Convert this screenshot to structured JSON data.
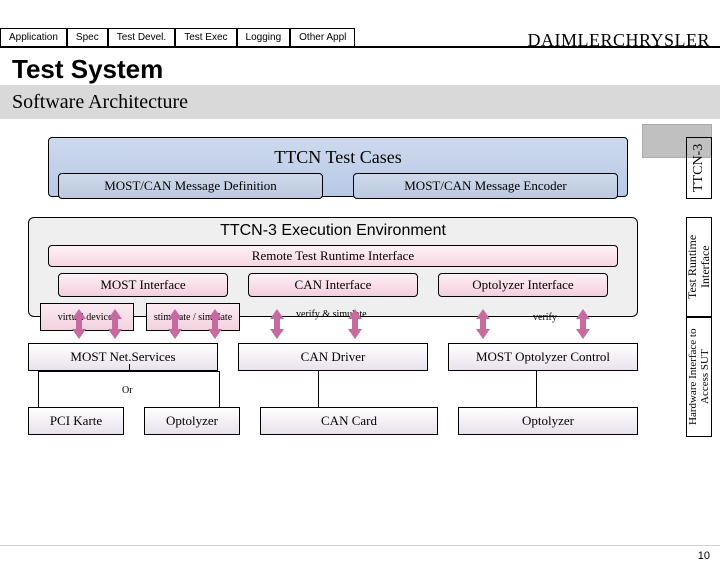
{
  "brand": "DAIMLERCHRYSLER",
  "tabs": [
    "Application",
    "Spec",
    "Test Devel.",
    "Test Exec",
    "Logging",
    "Other Appl"
  ],
  "title": "Test System",
  "subtitle": "Software Architecture",
  "ttcn_cases": "TTCN Test Cases",
  "msg_def": "MOST/CAN Message Definition",
  "msg_enc": "MOST/CAN Message Encoder",
  "side_ttcn3": "TTCN-3",
  "exec_env": "TTCN-3 Execution Environment",
  "rtri": "Remote Test Runtime Interface",
  "ifaces": [
    "MOST Interface",
    "CAN Interface",
    "Optolyzer Interface"
  ],
  "side_tri": "Test Runtime Interface",
  "virtual_devices": "virtual devices",
  "stim_sim": "stimulate / simulate",
  "verify_sim": "verify & simulate",
  "verify": "verify",
  "drivers": [
    "MOST Net.Services",
    "CAN Driver",
    "MOST Optolyzer Control"
  ],
  "or": "Or",
  "hw": [
    "PCI Karte",
    "Optolyzer",
    "CAN Card",
    "Optolyzer"
  ],
  "side_hw": "Hardware Interface to Access SUT",
  "page": "10"
}
